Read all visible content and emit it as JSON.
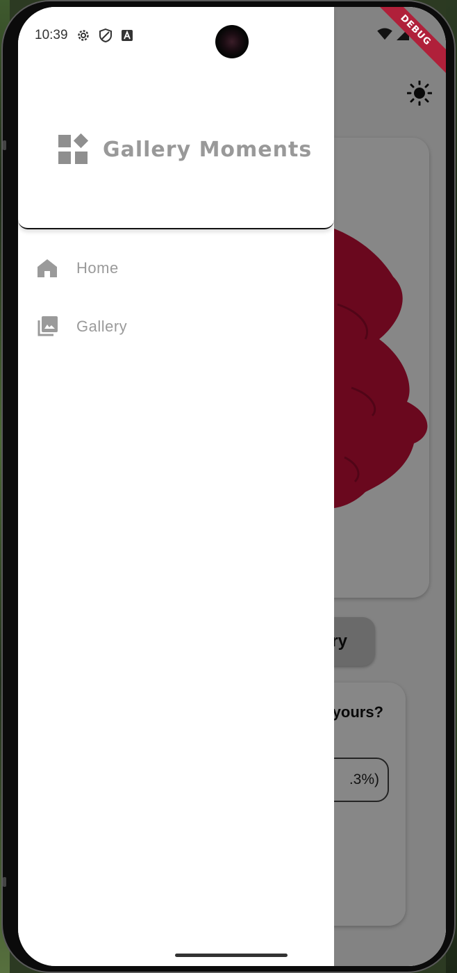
{
  "status_bar": {
    "time": "10:39",
    "left_icons": [
      "gear-icon",
      "shield-icon",
      "keyboard-a-icon"
    ],
    "right_icons": [
      "wifi-icon",
      "signal-icon",
      "battery-icon"
    ]
  },
  "debug_banner": {
    "label": "DEBUG",
    "color": "#B0203A"
  },
  "drawer": {
    "header": {
      "logo_icon": "widgets-icon",
      "title": "Gallery Moments"
    },
    "items": [
      {
        "label": "Home",
        "icon": "home-icon"
      },
      {
        "label": "Gallery",
        "icon": "photo-library-icon"
      }
    ]
  },
  "background_app": {
    "theme_toggle_icon": "sun-icon",
    "visible_button_text": "ry",
    "visible_question_text": "yours?",
    "visible_option_text": ".3%)"
  },
  "colors": {
    "drawer_text": "#9A9A9A",
    "flower": "#C8103A",
    "scrim": "rgba(0,0,0,0.47)"
  }
}
